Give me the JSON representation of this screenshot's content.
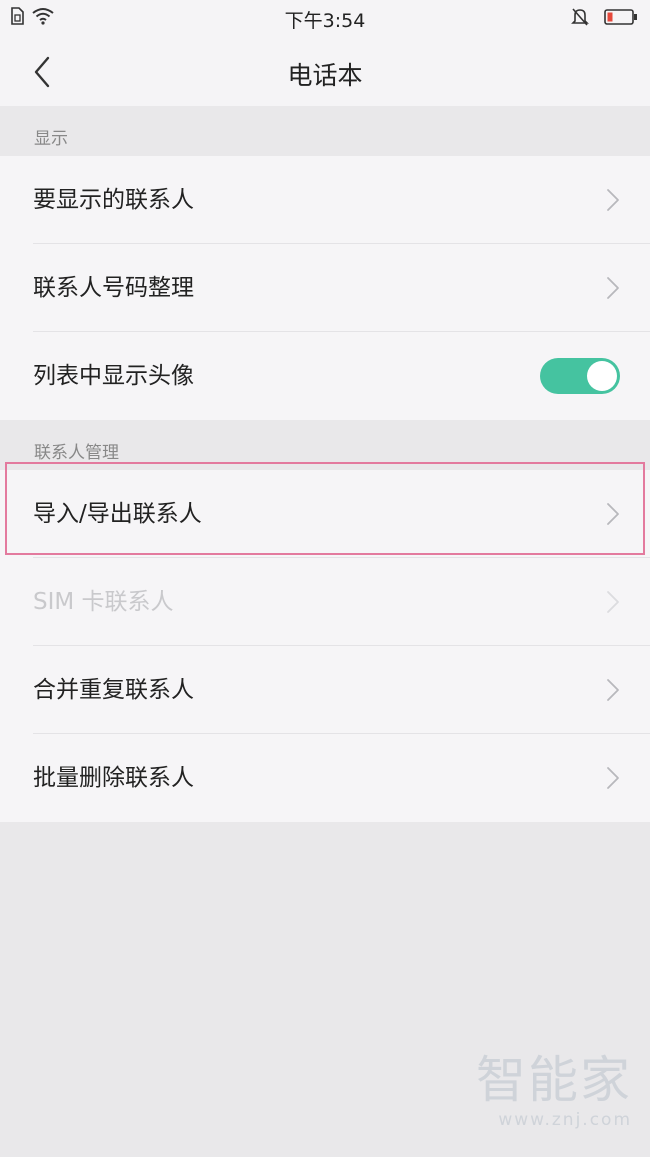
{
  "status_bar": {
    "time": "下午3:54",
    "icons": [
      "sim-icon",
      "wifi-icon",
      "mute-bell-icon",
      "battery-low-icon"
    ],
    "battery_color": "#e5483b"
  },
  "nav": {
    "title": "电话本",
    "back_icon": "chevron-left-icon"
  },
  "sections": [
    {
      "header": "显示",
      "items": [
        {
          "label": "要显示的联系人",
          "control": "chevron"
        },
        {
          "label": "联系人号码整理",
          "control": "chevron"
        },
        {
          "label": "列表中显示头像",
          "control": "toggle",
          "checked": true
        }
      ]
    },
    {
      "header": "联系人管理",
      "items": [
        {
          "label": "导入/导出联系人",
          "control": "chevron",
          "highlighted": true
        },
        {
          "label": "SIM 卡联系人",
          "control": "chevron",
          "disabled": true
        },
        {
          "label": "合并重复联系人",
          "control": "chevron"
        },
        {
          "label": "批量删除联系人",
          "control": "chevron"
        }
      ]
    }
  ],
  "colors": {
    "toggle_on": "#45c3a0",
    "highlight_border": "#e37a9e"
  },
  "watermark": {
    "brand": "智能家",
    "url": "www.znj.com"
  }
}
